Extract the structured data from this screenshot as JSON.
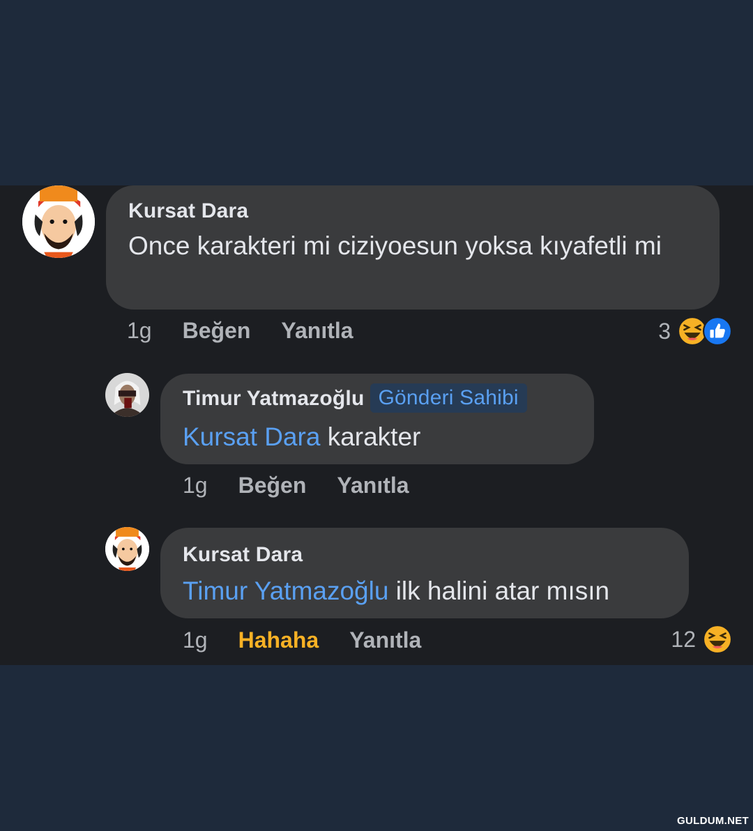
{
  "comments": [
    {
      "author": "Kursat Dara",
      "text": "Once karakteri mi ciziyoesun yoksa kıyafetli mi",
      "time": "1g",
      "like_label": "Beğen",
      "reply_label": "Yanıtla",
      "reaction_count": "3",
      "reactions": [
        "haha-icon",
        "like-icon"
      ]
    },
    {
      "author": "Timur Yatmazoğlu",
      "badge": "Gönderi Sahibi",
      "mention": "Kursat Dara",
      "text": " karakter",
      "time": "1g",
      "like_label": "Beğen",
      "reply_label": "Yanıtla"
    },
    {
      "author": "Kursat Dara",
      "mention": "Timur Yatmazoğlu",
      "text": " ilk halini atar mısın",
      "time": "1g",
      "reaction_label": "Hahaha",
      "reply_label": "Yanıtla",
      "reaction_count": "12",
      "reactions": [
        "haha-icon"
      ]
    }
  ],
  "watermark": "GULDUM.NET",
  "colors": {
    "background": "#1e2a3b",
    "panel": "#1c1e22",
    "bubble": "#3a3b3d",
    "mention": "#5aa0f2",
    "haha": "#f7b125",
    "like": "#1877f2"
  }
}
